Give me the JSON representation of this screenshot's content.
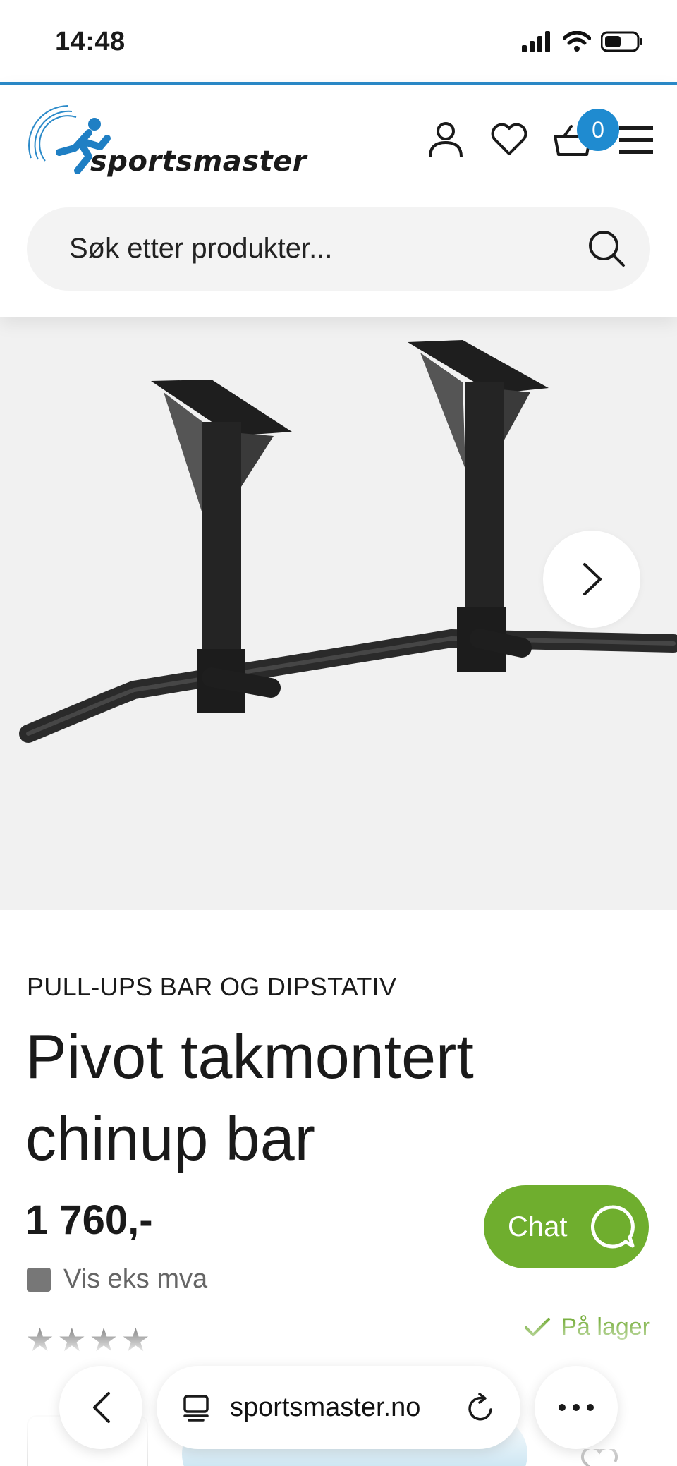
{
  "status_bar": {
    "time": "14:48"
  },
  "header": {
    "logo_text": "sportsmaster",
    "cart_count": "0",
    "search": {
      "placeholder": "Søk etter produkter..."
    }
  },
  "product": {
    "category": "PULL-UPS BAR OG DIPSTATIV",
    "title": "Pivot takmontert chinup bar",
    "price": "1 760,-",
    "vat_toggle_label": "Vis eks mva",
    "stock_label": "På lager"
  },
  "chat": {
    "label": "Chat"
  },
  "browser": {
    "url": "sportsmaster.no"
  },
  "colors": {
    "accent_blue": "#1f8bd0",
    "chat_green": "#6fae2e",
    "stock_green": "#7ab040"
  },
  "icons": [
    "account-icon",
    "heart-icon",
    "cart-icon",
    "menu-icon",
    "search-icon",
    "chevron-right-icon",
    "chat-icon",
    "check-icon",
    "back-icon",
    "reader-icon",
    "reload-icon",
    "more-icon"
  ]
}
